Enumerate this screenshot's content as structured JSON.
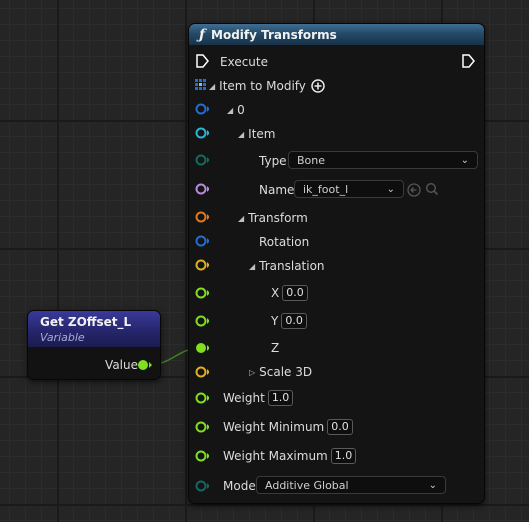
{
  "colors": {
    "exec": "#ffffff",
    "struct_blue": "#1f6fd0",
    "struct_cyan": "#2ab6d6",
    "enum_teal": "#0f6b60",
    "name_purple": "#b98ae0",
    "transform_orange": "#e07820",
    "rotator_blue": "#1f6fd0",
    "vector_yellow": "#e0b020",
    "float_green": "#7ee01e",
    "header_blue": "#2a5878",
    "var_header": "#2b2b80"
  },
  "variable_node": {
    "title": "Get ZOffset_L",
    "subtitle": "Variable",
    "output_label": "Value"
  },
  "function_node": {
    "title": "Modify Transforms",
    "icon": "function-f-icon",
    "execute_label": "Execute",
    "item_to_modify_label": "Item to Modify",
    "index_label": "0",
    "item_label": "Item",
    "type_label": "Type",
    "type_value": "Bone",
    "name_label": "Name",
    "name_value": "ik_foot_l",
    "transform_label": "Transform",
    "rotation_label": "Rotation",
    "translation_label": "Translation",
    "x_label": "X",
    "x_value": "0.0",
    "y_label": "Y",
    "y_value": "0.0",
    "z_label": "Z",
    "scale_label": "Scale 3D",
    "weight_label": "Weight",
    "weight_value": "1.0",
    "weight_min_label": "Weight Minimum",
    "weight_min_value": "0.0",
    "weight_max_label": "Weight Maximum",
    "weight_max_value": "1.0",
    "mode_label": "Mode",
    "mode_value": "Additive Global"
  }
}
